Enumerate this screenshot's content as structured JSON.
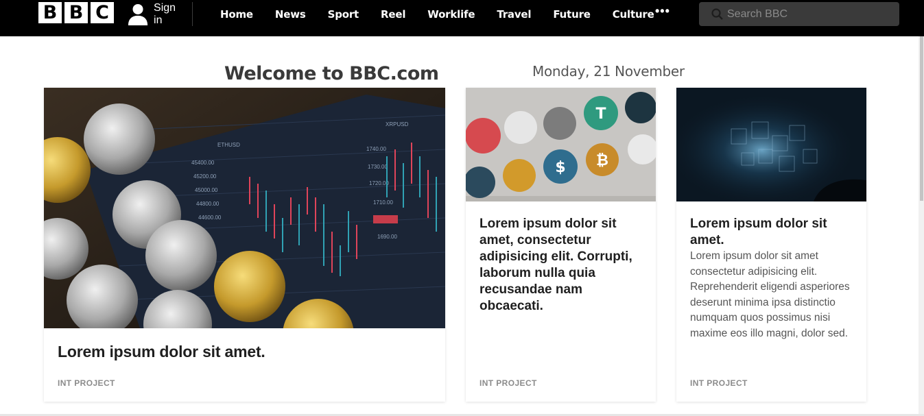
{
  "header": {
    "logo_letters": [
      "B",
      "B",
      "C"
    ],
    "signin_label": "Sign in",
    "nav_items": [
      "Home",
      "News",
      "Sport",
      "Reel",
      "Worklife",
      "Travel",
      "Future",
      "Culture"
    ],
    "more_label": "•••",
    "search_placeholder": "Search BBC"
  },
  "main": {
    "welcome_title": "Welcome to BBC.com",
    "date": "Monday, 21 November",
    "cards": [
      {
        "title": "Lorem ipsum dolor sit amet.",
        "tag": "INT PROJECT",
        "image": "crypto-trading-chart-with-coins"
      },
      {
        "title": "Lorem ipsum dolor sit amet, consectetur adipisicing elit. Corrupti, laborum nulla quia recusandae nam obcaecati.",
        "tag": "INT PROJECT",
        "image": "cryptocurrency-tokens"
      },
      {
        "title": "Lorem ipsum dolor sit amet.",
        "description": "Lorem ipsum dolor sit amet consectetur adipisicing elit. Reprehenderit eligendi asperiores deserunt minima ipsa distinctio numquam quos possimus nisi maxime eos illo magni, dolor sed.",
        "tag": "INT PROJECT",
        "image": "blockchain-network-cubes"
      }
    ]
  },
  "colors": {
    "header_bg": "#000000",
    "search_bg": "#3a3a3a",
    "text_dark": "#1f1f1f",
    "tag_gray": "#8b8b8b"
  }
}
